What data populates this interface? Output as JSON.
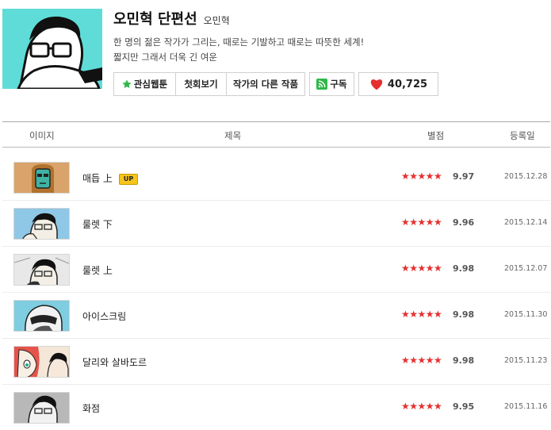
{
  "header": {
    "title": "오민혁 단편선",
    "author": "오민혁",
    "description_line1": "한 명의 젊은 작가가 그리는, 때로는 기발하고 때로는 따뜻한 세계!",
    "description_line2": "짧지만 그래서 더욱 긴 여운"
  },
  "buttons": {
    "favorite": "관심웹툰",
    "first_episode": "첫회보기",
    "other_works": "작가의 다른 작품",
    "subscribe": "구독",
    "likes": "40,725"
  },
  "table": {
    "col_image": "이미지",
    "col_title": "제목",
    "col_rating": "별점",
    "col_date": "등록일"
  },
  "episodes": [
    {
      "title": "매듭 上",
      "badge": "UP",
      "stars": "★★★★★",
      "rating": "9.97",
      "date": "2015.12.28"
    },
    {
      "title": "룰렛 下",
      "stars": "★★★★★",
      "rating": "9.96",
      "date": "2015.12.14"
    },
    {
      "title": "룰렛 上",
      "stars": "★★★★★",
      "rating": "9.98",
      "date": "2015.12.07"
    },
    {
      "title": "아이스크림",
      "stars": "★★★★★",
      "rating": "9.98",
      "date": "2015.11.30"
    },
    {
      "title": "달리와 살바도르",
      "stars": "★★★★★",
      "rating": "9.98",
      "date": "2015.11.23"
    },
    {
      "title": "화점",
      "stars": "★★★★★",
      "rating": "9.95",
      "date": "2015.11.16"
    }
  ],
  "icons": {
    "favorite": "star-icon",
    "subscribe": "rss-icon",
    "likes": "heart-icon"
  },
  "colors": {
    "cover_bg": "#5fdcd8",
    "star_red": "#e5302f",
    "rss_green": "#2fb84a",
    "up_badge": "#f7c51a"
  }
}
